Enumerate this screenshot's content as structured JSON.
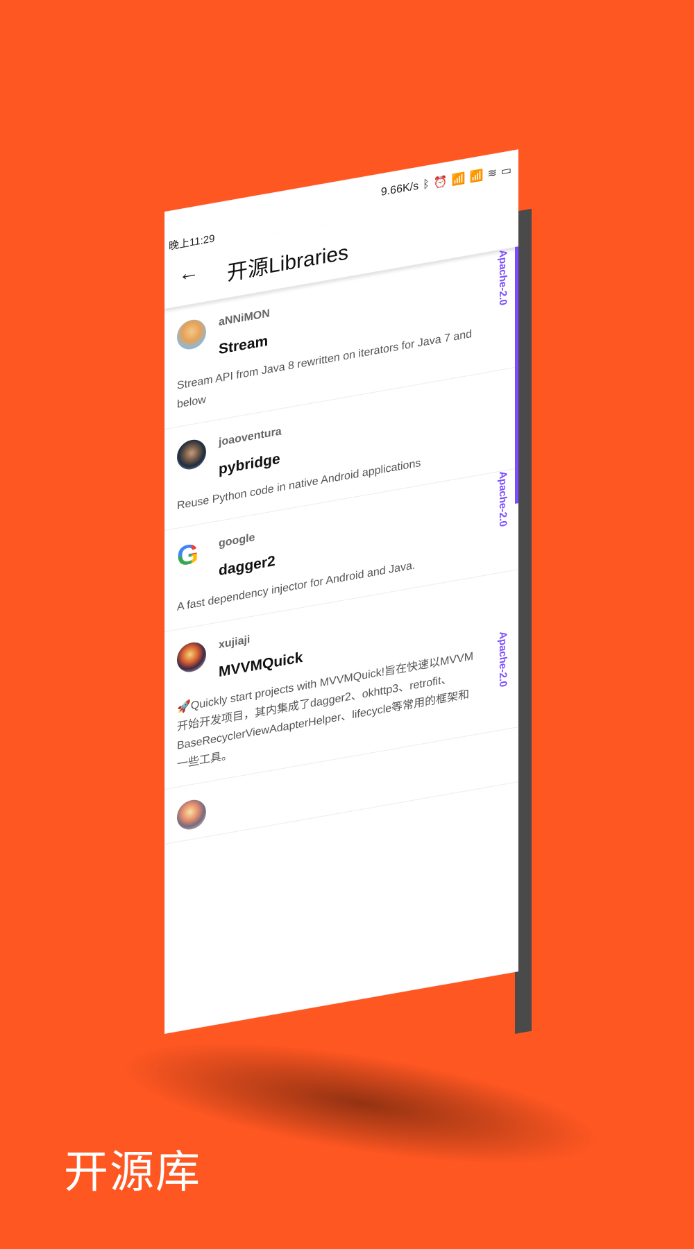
{
  "status_bar": {
    "time": "晚上11:29",
    "speed": "9.66K/s",
    "icons": [
      "bluetooth-icon",
      "alarm-icon",
      "signal-icon",
      "signal-icon",
      "wifi-icon",
      "battery-icon"
    ]
  },
  "toolbar": {
    "title": "开源Libraries",
    "back_icon": "←"
  },
  "libraries": [
    {
      "author": "aNNiMON",
      "name": "Stream",
      "description": "Stream API from Java 8 rewritten on iterators for Java 7 and below",
      "license": "Apache-2.0"
    },
    {
      "author": "joaoventura",
      "name": "pybridge",
      "description": "Reuse Python code in native Android applications",
      "license": ""
    },
    {
      "author": "google",
      "name": "dagger2",
      "description": "A fast dependency injector for Android and Java.",
      "license": "Apache-2.0"
    },
    {
      "author": "xujiaji",
      "name": "MVVMQuick",
      "description": "🚀Quickly start projects with MVVMQuick!旨在快速以MVVM开始开发项目，其内集成了dagger2、okhttp3、retrofit、BaseRecyclerViewAdapterHelper、lifecycle等常用的框架和一些工具。",
      "license": "Apache-2.0"
    }
  ],
  "caption": "开源库",
  "colors": {
    "background": "#ff5722",
    "accent": "#7c4dff"
  }
}
